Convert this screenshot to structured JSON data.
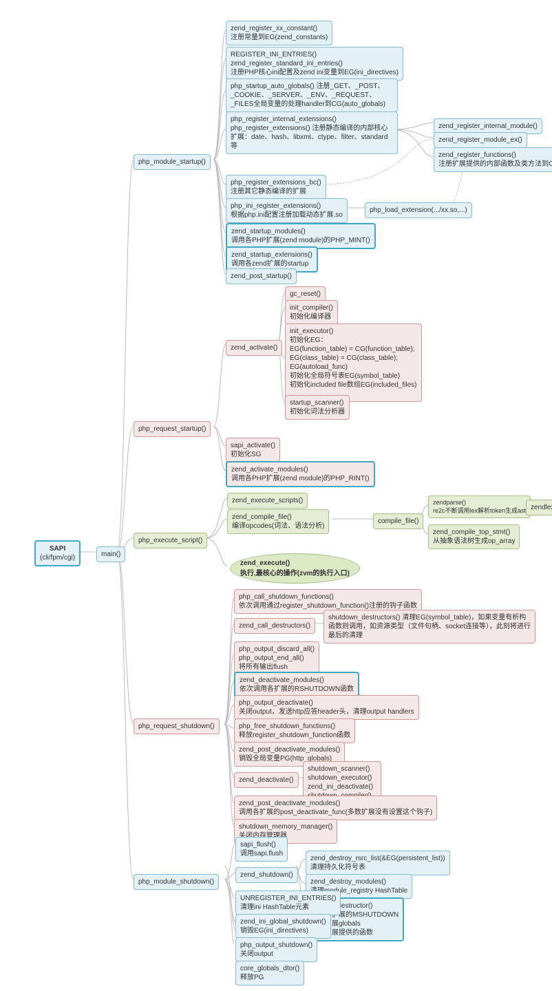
{
  "sapi": {
    "title": "SAPI",
    "sub": "(cli/fpm/cgi)"
  },
  "main": "main()",
  "pms": "php_module_startup()",
  "prs": "php_request_startup()",
  "pes": "php_execute_script()",
  "prd": "php_request_shutdown()",
  "pmd": "php_module_shutdown()",
  "ms": {
    "n1": "zend_register_xx_constant()\n注册常量到EG(zend_constants)",
    "n2": "REGISTER_INI_ENTRIES()\nzend_register_standard_ini_entries()\n注册PHP核心ini配置及zend ini变量到EG(ini_directives)",
    "n3": "php_startup_auto_globals()\n注册_GET、_POST、_COOKIE、_SERVER、_ENV、_REQUEST、_FILES全局变量的处理handler到CG(auto_globals)",
    "n4": "php_register_internal_extensions()\nphp_register_extensions()\n注册静态编译的内部核心扩展：date、hash、libxml、ctype、filter、standard等",
    "n4a": "zend_register_internal_module()",
    "n4b": "zend_register_module_ex()",
    "n4c": "zend_register_functions()\n注册扩展提供的内部函数及类方法到CG",
    "n5": "php_register_extensions_bc()\n注册其它静态编译的扩展",
    "n6": "php_ini_register_extensions()\n根据php.ini配置注册加载动态扩展.so",
    "n6a": "php_load_extension(.../xx.so,...)",
    "n7": "zend_startup_modules()\n调用各PHP扩展(zend module)的PHP_MINT()",
    "n8": "zend_startup_extensions()\n调用各zend扩展的startup",
    "n9": "zend_post_startup()"
  },
  "rs": {
    "za": "zend_activate()",
    "za1": "gc_reset()",
    "za2": "init_compiler()\n初始化编译器",
    "za3": "init_executor()\n初始化EG：\nEG(function_table) = CG(function_table);\nEG(class_table) = CG(class_table);\nEG(autoload_func)\n初始化全局符号表EG(symbol_table)\n初始化included file数组EG(included_files)\n...",
    "za4": "startup_scanner()\n初始化词法分析器",
    "sa": "sapi_activate()\n初始化SG",
    "zam": "zend_activate_modules()\n调用各PHP扩展(zend module)的PHP_RINT()"
  },
  "es": {
    "zes": "zend_execute_scripts()",
    "zcf": "zend_compile_file()\n编译opcodes(词法、语法分析)",
    "cf": "compile_file()",
    "zp": "zendparse()\nre2c不断调用lex解析token生成ast",
    "zl": "zendlex()",
    "zcts": "zend_compile_top_stmt()\n从抽象语法树生成op_array",
    "ze": "zend_execute()\n执行,最核心的操作(zvm的执行入口)"
  },
  "rd": {
    "n1": "php_call_shutdown_functions()\n依次调用通过register_shutdown_function()注册的钩子函数",
    "n2": "zend_call_destructors()",
    "n2a": "shutdown_destructors()\n清理EG(symbol_table)，如果变量有析构函数则调用，如资源类型（文件句柄、socket连接等），此刻将进行最后的清理",
    "n3": "php_output_discard_all()\nphp_output_end_all()\n将所有输出flush",
    "n4": "zend_deactivate_modules()\n依次调用各扩展的RSHUTDOWN函数",
    "n5": "php_output_deactivate()\n关闭output，发送http应答header头，清理output handlers",
    "n6": "php_free_shutdown_functions()\n释放register_shutdown_function函数",
    "n7": "zend_post_deactivate_modules()\n销毁全局变量PG(http_globals)",
    "n8": "zend_deactivate()",
    "n8a": "shutdown_scanner()\nshutdown_executor()\nzend_ini_deactivate()\nshutdown_compiler()\n关闭编译器、执行器等",
    "n9": "zend_post_deactivate_modules()\n调用各扩展的post_deactivate_func(多数扩展没有设置这个钩子)",
    "n10": "shutdown_memory_manager()\n关闭内存管理器"
  },
  "md": {
    "n1": "sapi_flush()\n调用sapi.flush",
    "n2": "zend_shutdown()",
    "n2a": "zend_destroy_rsrc_list(&EG(persistent_list))\n清理持久化符号表",
    "n2b": "zend_destroy_modules()\n清理module_registry HashTable",
    "n2c": "module_destructor()\n调用各扩展的MSHUTDOWN\n清理扩展globals\n注销扩展提供的函数",
    "n3": "UNREGISTER_INI_ENTRIES()\n清理ini HashTable元素",
    "n4": "zend_ini_global_shutdown()\n销毁EG(ini_directives)",
    "n5": "php_output_shutdown()\n关闭output",
    "n6": "core_globals_dtor()\n释放PG"
  }
}
